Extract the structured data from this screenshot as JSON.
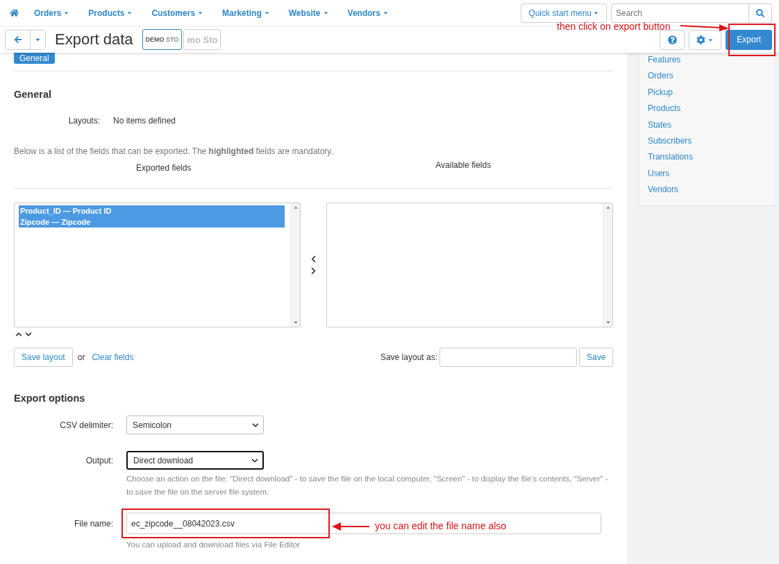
{
  "nav": {
    "items": [
      {
        "label": "Orders"
      },
      {
        "label": "Products"
      },
      {
        "label": "Customers"
      },
      {
        "label": "Marketing"
      },
      {
        "label": "Website"
      },
      {
        "label": "Vendors"
      }
    ],
    "quick_start": "Quick start menu",
    "search": {
      "placeholder": "Search"
    }
  },
  "toolbar": {
    "title": "Export data",
    "store_badges": [
      {
        "label": "**DEMO** STO",
        "selected": true
      },
      {
        "label": "mo Sto",
        "selected": false
      }
    ],
    "export_button": "Export"
  },
  "tabs": [
    {
      "label": "General",
      "selected": true
    }
  ],
  "section_title": "General",
  "layouts": {
    "label": "Layouts:",
    "value": "No items defined"
  },
  "description": "Below is a list of the fields that can be exported. The **highlighted** fields are mandatory.",
  "exported_fields": {
    "heading": "Exported fields",
    "items": [
      {
        "label": "Product_ID — Product ID",
        "selected": true
      },
      {
        "label": "Zipcode — Zipcode",
        "selected": true
      }
    ]
  },
  "available_fields": {
    "heading": "Available fields"
  },
  "layout_actions": {
    "save_layout": "Save layout",
    "or": "or",
    "clear_fields": "Clear fields",
    "save_as_label": "Save layout as:",
    "save": "Save"
  },
  "export_options": {
    "title": "Export options",
    "fields": [
      {
        "kind": "select",
        "label": "CSV delimiter:",
        "value": "Semicolon",
        "focused": false
      },
      {
        "kind": "select",
        "label": "Output:",
        "value": "Direct download",
        "focused": true,
        "help": "Choose an action on the file: \"Direct download\" - to save the file on the local computer, \"Screen\" - to display the file's contents, \"Server\" - to save the file on the server file system."
      },
      {
        "kind": "text",
        "label": "File name:",
        "value": "ec_zipcode__08042023.csv",
        "help": "You can upload and download files via File Editor"
      }
    ]
  },
  "sidebar": {
    "items": [
      {
        "label": "Features"
      },
      {
        "label": "Orders"
      },
      {
        "label": "Pickup"
      },
      {
        "label": "Products"
      },
      {
        "label": "States"
      },
      {
        "label": "Subscribers"
      },
      {
        "label": "Translations"
      },
      {
        "label": "Users"
      },
      {
        "label": "Vendors"
      }
    ]
  },
  "annotations": [
    {
      "text": "then click on export button"
    },
    {
      "text": "you can edit the file name also"
    }
  ]
}
